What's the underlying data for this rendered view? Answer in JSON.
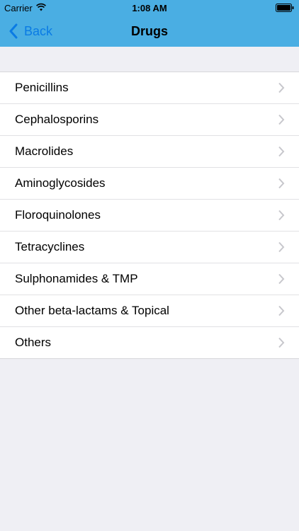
{
  "status_bar": {
    "carrier": "Carrier",
    "wifi_icon": "wifi-icon",
    "time": "1:08 AM",
    "battery_icon": "battery-icon"
  },
  "nav": {
    "back_label": "Back",
    "title": "Drugs",
    "back_icon": "chevron-left-icon"
  },
  "colors": {
    "nav_bar": "#4aaee3",
    "back_tint": "#0a7be4",
    "background": "#efeff4"
  },
  "list": {
    "items": [
      {
        "label": "Penicillins"
      },
      {
        "label": "Cephalosporins"
      },
      {
        "label": "Macrolides"
      },
      {
        "label": "Aminoglycosides"
      },
      {
        "label": "Floroquinolones"
      },
      {
        "label": "Tetracyclines"
      },
      {
        "label": "Sulphonamides & TMP"
      },
      {
        "label": "Other beta-lactams & Topical"
      },
      {
        "label": "Others"
      }
    ],
    "accessory_icon": "chevron-right-icon"
  }
}
